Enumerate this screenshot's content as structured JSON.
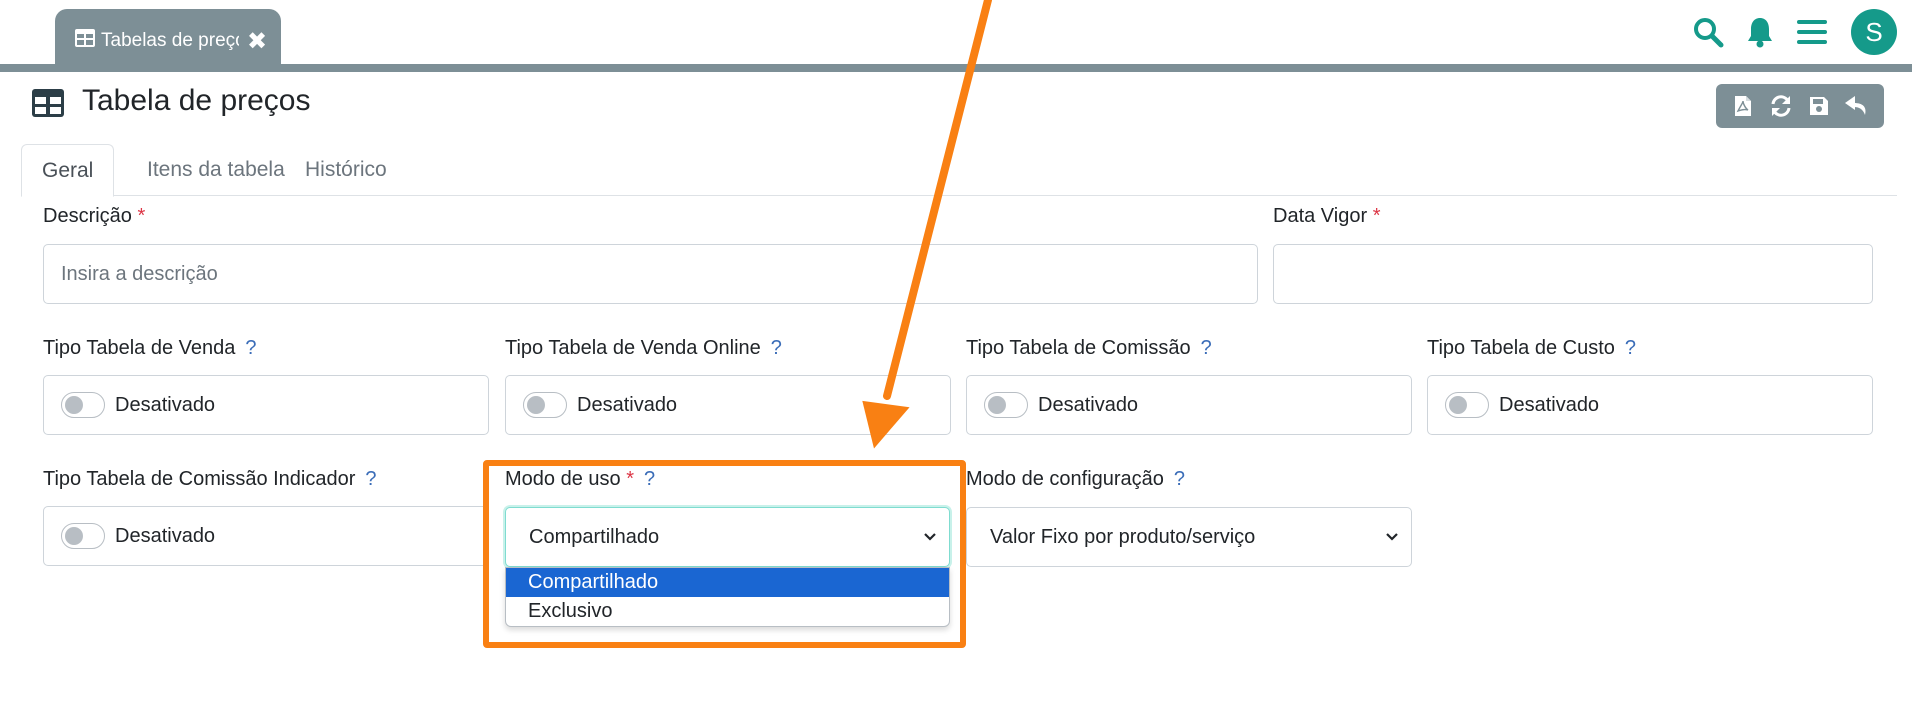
{
  "top_tab": {
    "title": "Tabelas de preços",
    "close_glyph": "✖"
  },
  "top_icons": [
    "search-icon",
    "bell-icon",
    "menu-icon"
  ],
  "user": {
    "initial": "S"
  },
  "page": {
    "title": "Tabela de preços"
  },
  "toolbar_icons": [
    "pdf-icon",
    "refresh-icon",
    "save-icon",
    "undo-icon"
  ],
  "tabs": [
    {
      "label": "Geral"
    },
    {
      "label": "Itens da tabela"
    },
    {
      "label": "Histórico"
    }
  ],
  "form": {
    "descricao": {
      "label": "Descrição",
      "required_mark": "*",
      "placeholder": "Insira a descrição"
    },
    "data_vigor": {
      "label": "Data Vigor",
      "required_mark": "*",
      "value": ""
    },
    "toggles": [
      {
        "label": "Tipo Tabela de Venda",
        "help": "?",
        "state": "Desativado"
      },
      {
        "label": "Tipo Tabela de Venda Online",
        "help": "?",
        "state": "Desativado"
      },
      {
        "label": "Tipo Tabela de Comissão",
        "help": "?",
        "state": "Desativado"
      },
      {
        "label": "Tipo Tabela de Custo",
        "help": "?",
        "state": "Desativado"
      },
      {
        "label": "Tipo Tabela de Comissão Indicador",
        "help": "?",
        "state": "Desativado"
      }
    ],
    "modo_uso": {
      "label": "Modo de uso",
      "required_mark": "*",
      "help": "?",
      "value": "Compartilhado",
      "options": [
        "Compartilhado",
        "Exclusivo"
      ]
    },
    "modo_config": {
      "label": "Modo de configuração",
      "help": "?",
      "value": "Valor Fixo por produto/serviço"
    }
  },
  "colors": {
    "tab_bar": "#7d8f96",
    "brand": "#159a8a",
    "annotation": "#f98013",
    "option_selected": "#1a66d2",
    "required": "#dc3545"
  }
}
